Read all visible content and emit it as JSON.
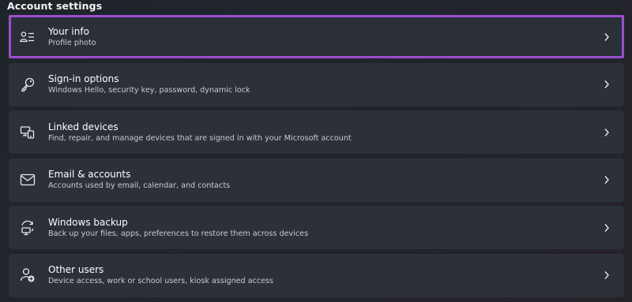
{
  "section": {
    "title": "Account settings"
  },
  "items": [
    {
      "title": "Your info",
      "subtitle": "Profile photo",
      "icon": "person-list-icon"
    },
    {
      "title": "Sign-in options",
      "subtitle": "Windows Hello, security key, password, dynamic lock",
      "icon": "key-icon"
    },
    {
      "title": "Linked devices",
      "subtitle": "Find, repair, and manage devices that are signed in with your Microsoft account",
      "icon": "devices-icon"
    },
    {
      "title": "Email & accounts",
      "subtitle": "Accounts used by email, calendar, and contacts",
      "icon": "mail-icon"
    },
    {
      "title": "Windows backup",
      "subtitle": "Back up your files, apps, preferences to restore them across devices",
      "icon": "backup-icon"
    },
    {
      "title": "Other users",
      "subtitle": "Device access, work or school users, kiosk assigned access",
      "icon": "add-user-icon"
    }
  ],
  "colors": {
    "highlight": "#9b4fd0",
    "card": "#2b3039"
  }
}
